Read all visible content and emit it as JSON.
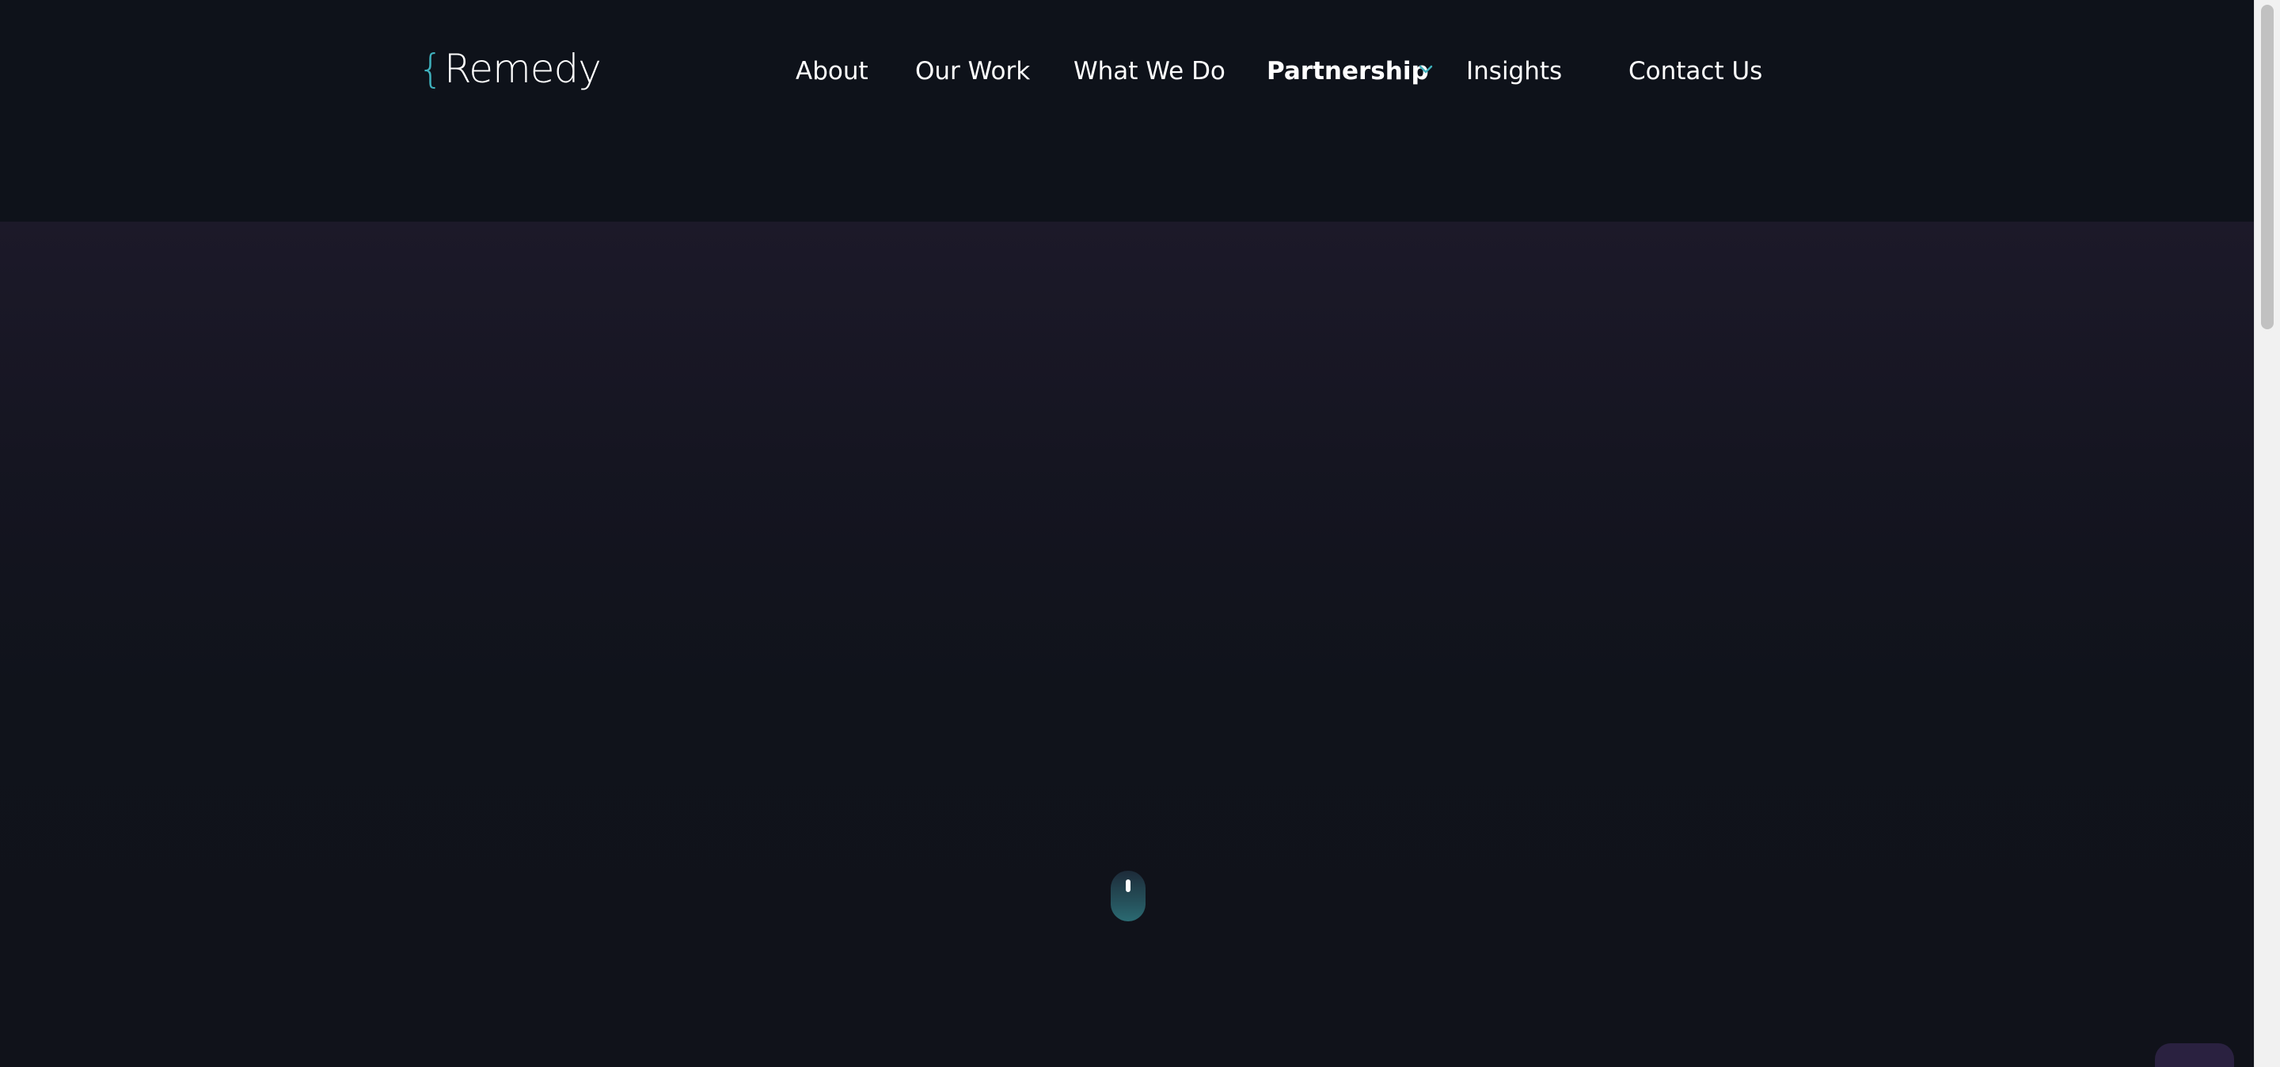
{
  "brand": {
    "brace": "{",
    "name": "Remedy",
    "accent_color": "#3fb1bd"
  },
  "nav": {
    "items": [
      {
        "label": "About"
      },
      {
        "label": "Our Work"
      },
      {
        "label": "What We Do"
      },
      {
        "label": "Partnership",
        "has_dropdown": true,
        "icon": "chevron-down-icon"
      },
      {
        "label": "Insights"
      },
      {
        "label": "Contact Us"
      }
    ]
  },
  "hero": {
    "scroll_indicator_icon": "mouse-icon"
  },
  "colors": {
    "header_bg": "#0e121a",
    "hero_top": "#1c1929",
    "hero_bottom": "#10121a",
    "text": "#ffffff"
  }
}
